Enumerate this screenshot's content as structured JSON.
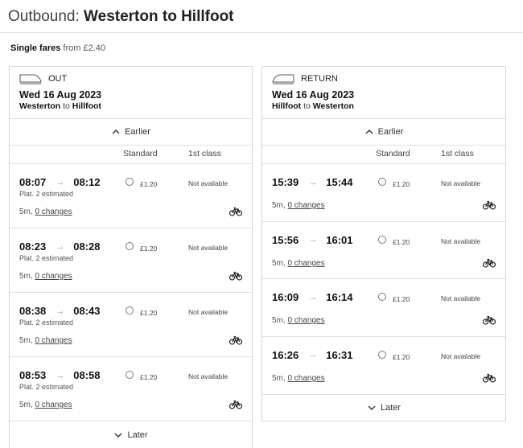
{
  "header": {
    "direction": "Outbound:",
    "route": "Westerton to Hillfoot"
  },
  "fares_note": {
    "label": "Single fares",
    "from_text": "from £2.40"
  },
  "out": {
    "direction": "OUT",
    "icon": "train-icon",
    "date": "Wed 16 Aug 2023",
    "origin": "Westerton",
    "to_word": "to",
    "destination": "Hillfoot",
    "earlier_label": "Earlier",
    "later_label": "Later",
    "col_standard": "Standard",
    "col_first": "1st class",
    "journeys": [
      {
        "depart": "08:07",
        "arrive": "08:12",
        "platform": "Plat. 2 estimated",
        "duration": "5m,",
        "changes": "0 changes",
        "price": "£1.20",
        "first_class": "Not available"
      },
      {
        "depart": "08:23",
        "arrive": "08:28",
        "platform": "Plat. 2 estimated",
        "duration": "5m,",
        "changes": "0 changes",
        "price": "£1.20",
        "first_class": "Not available"
      },
      {
        "depart": "08:38",
        "arrive": "08:43",
        "platform": "Plat. 2 estimated",
        "duration": "5m,",
        "changes": "0 changes",
        "price": "£1.20",
        "first_class": "Not available"
      },
      {
        "depart": "08:53",
        "arrive": "08:58",
        "platform": "Plat. 2 estimated",
        "duration": "5m,",
        "changes": "0 changes",
        "price": "£1.20",
        "first_class": "Not available"
      }
    ]
  },
  "ret": {
    "direction": "RETURN",
    "icon": "train-icon",
    "date": "Wed 16 Aug 2023",
    "origin": "Hillfoot",
    "to_word": "to",
    "destination": "Westerton",
    "earlier_label": "Earlier",
    "later_label": "Later",
    "col_standard": "Standard",
    "col_first": "1st class",
    "journeys": [
      {
        "depart": "15:39",
        "arrive": "15:44",
        "duration": "5m,",
        "changes": "0 changes",
        "price": "£1.20",
        "first_class": "Not available"
      },
      {
        "depart": "15:56",
        "arrive": "16:01",
        "duration": "5m,",
        "changes": "0 changes",
        "price": "£1.20",
        "first_class": "Not available"
      },
      {
        "depart": "16:09",
        "arrive": "16:14",
        "duration": "5m,",
        "changes": "0 changes",
        "price": "£1.20",
        "first_class": "Not available"
      },
      {
        "depart": "16:26",
        "arrive": "16:31",
        "duration": "5m,",
        "changes": "0 changes",
        "price": "£1.20",
        "first_class": "Not available"
      }
    ]
  },
  "icons": {
    "arrow": "arrow-right-icon",
    "bike": "bicycle-icon",
    "chevron_up": "chevron-up-icon",
    "chevron_down": "chevron-down-icon"
  }
}
